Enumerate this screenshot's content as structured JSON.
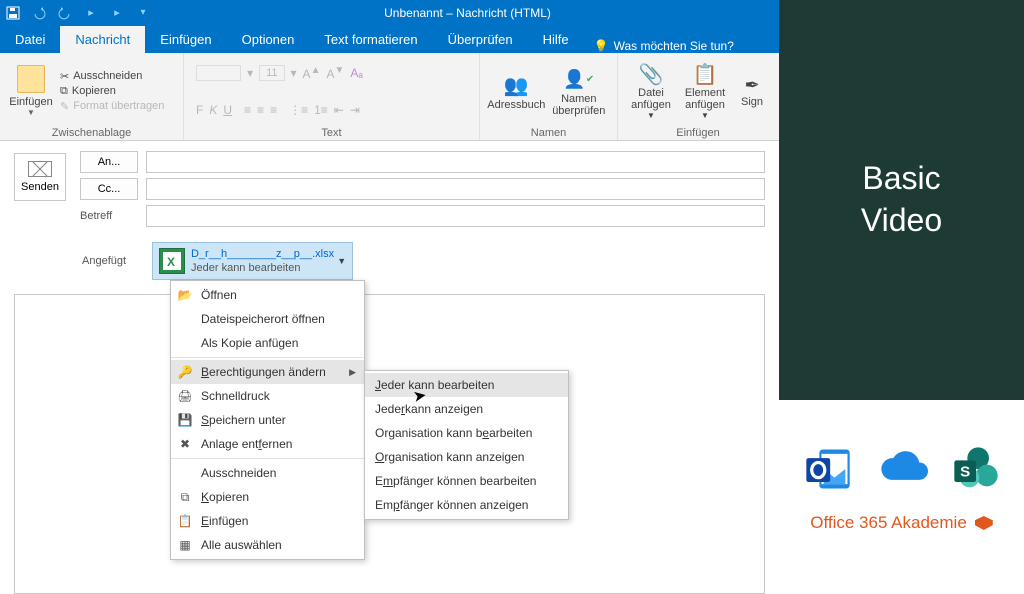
{
  "window_title": "Unbenannt – Nachricht (HTML)",
  "tabs": [
    "Datei",
    "Nachricht",
    "Einfügen",
    "Optionen",
    "Text formatieren",
    "Überprüfen",
    "Hilfe"
  ],
  "tell_me": "Was möchten Sie tun?",
  "clipboard": {
    "paste": "Einfügen",
    "cut": "Ausschneiden",
    "copy": "Kopieren",
    "format": "Format übertragen",
    "label": "Zwischenablage"
  },
  "text_group": "Text",
  "names": {
    "book": "Adressbuch",
    "check": "Namen überprüfen",
    "label": "Namen"
  },
  "insert": {
    "file": "Datei anfügen",
    "item": "Element anfügen",
    "sign": "Sign",
    "label": "Einfügen"
  },
  "compose": {
    "send": "Senden",
    "to": "An...",
    "cc": "Cc...",
    "subject": "Betreff",
    "attached": "Angefügt"
  },
  "attachment": {
    "filename": "D_r__h________z__p__.xlsx",
    "subtitle": "Jeder kann bearbeiten"
  },
  "ctx": {
    "open": "Öffnen",
    "openloc": "Dateispeicherort öffnen",
    "ascopy": "Als Kopie anfügen",
    "perm": "Berechtigungen ändern",
    "quick": "Schnelldruck",
    "saveas": "Speichern unter",
    "remove": "Anlage entfernen",
    "cut": "Ausschneiden",
    "copy": "Kopieren",
    "paste": "Einfügen",
    "selectall": "Alle auswählen"
  },
  "perm": [
    "Jeder kann bearbeiten",
    "Jeder kann anzeigen",
    "Organisation kann bearbeiten",
    "Organisation kann anzeigen",
    "Empfänger können bearbeiten",
    "Empfänger können anzeigen"
  ],
  "right": {
    "title": "Basic\nVideo",
    "brand": "Office 365 Akademie"
  }
}
